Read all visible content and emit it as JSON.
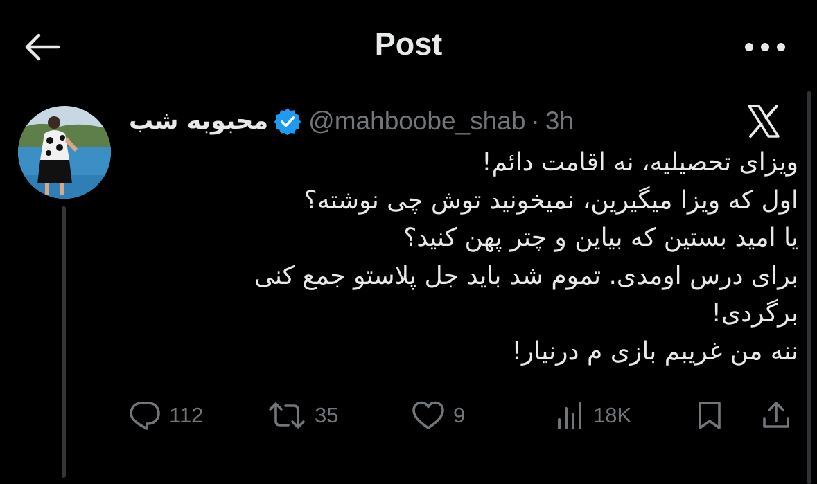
{
  "header": {
    "title": "Post"
  },
  "post": {
    "display_name": "محبوبه شب",
    "handle": "@mahboobe_shab",
    "separator": "·",
    "time": "3h",
    "text_lines": [
      "ویزای تحصیلیه، نه اقامت دائم!",
      "اول که ویزا میگیرین، نمیخونید توش چی نوشته؟",
      "یا امید بستین که بیاین و چتر پهن کنید؟",
      "برای درس اومدی. تموم شد باید جل پلاستو جمع کنی",
      "برگردی!",
      "ننه من غریبم بازی م درنیار!"
    ],
    "stats": {
      "replies": "112",
      "reposts": "35",
      "likes": "9",
      "views": "18K"
    }
  },
  "icons": {
    "back": "arrow-left-icon",
    "more": "more-horizontal-icon",
    "verified": "verified-badge-icon",
    "platform": "x-logo-icon",
    "reply": "reply-icon",
    "repost": "repost-icon",
    "like": "heart-icon",
    "views": "views-icon",
    "bookmark": "bookmark-icon",
    "share": "share-icon"
  },
  "colors": {
    "background": "#000000",
    "text_primary": "#e7e9ea",
    "text_secondary": "#71767b",
    "verified_blue": "#1d9bf0",
    "divider": "#333639"
  }
}
